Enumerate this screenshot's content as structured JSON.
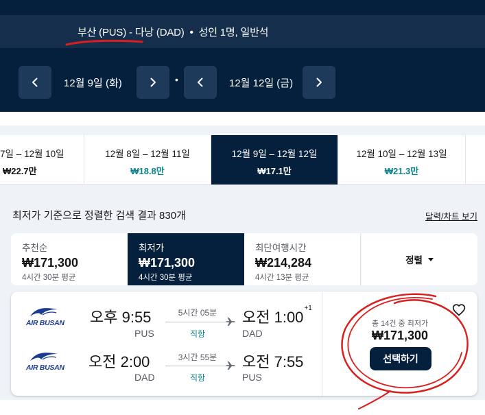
{
  "search": {
    "route": "부산 (PUS) - 다낭 (DAD)",
    "separator": "•",
    "passengers": "성인 1명, 일반석"
  },
  "dates": {
    "depart": "12월 9일 (화)",
    "return": "12월 12일 (금)",
    "separator": "•",
    "prev_icon": "chevron-left-icon",
    "next_icon": "chevron-right-icon"
  },
  "date_tabs": [
    {
      "range": "7일 – 12월 10일",
      "price": "₩22.7만",
      "price_color": "#161616"
    },
    {
      "range": "12월 8일 – 12월 11일",
      "price": "₩18.8만",
      "price_color": "#0c838a"
    },
    {
      "range": "12월 9일 – 12월 12일",
      "price": "₩17.1만",
      "price_color": "#ffffff"
    },
    {
      "range": "12월 10일 – 12월 13일",
      "price": "₩21.3만",
      "price_color": "#0c838a"
    }
  ],
  "results": {
    "count_text": "최저가 기준으로 정렬한 검색 결과 830개",
    "chart_link": "달력/차트 보기"
  },
  "sort_tabs": [
    {
      "label": "추천순",
      "price": "₩171,300",
      "sub": "4시간 30분 평균"
    },
    {
      "label": "최저가",
      "price": "₩171,300",
      "sub": "4시간 30분 평균"
    },
    {
      "label": "최단여행시간",
      "price": "₩214,284",
      "sub": "4시간 13분 평균"
    }
  ],
  "sort_button": {
    "label": "정렬"
  },
  "card": {
    "airline": "AIR BUSAN",
    "outbound": {
      "depart_time": "오후 9:55",
      "depart_code": "PUS",
      "duration": "5시간 05분",
      "stops": "직항",
      "arrive_time": "오전 1:00",
      "day_offset": "+1",
      "arrive_code": "DAD"
    },
    "inbound": {
      "depart_time": "오전 2:00",
      "depart_code": "DAD",
      "duration": "3시간 55분",
      "stops": "직항",
      "arrive_time": "오전 7:55",
      "arrive_code": "PUS"
    },
    "deal_label": "총 14건 중 최저가",
    "price": "₩171,300",
    "select_label": "선택하기"
  },
  "colors": {
    "header_bg": "#05203c",
    "route_bar_bg": "#142e4c",
    "accent_teal": "#0c838a",
    "annotation_red": "#d9201f"
  }
}
